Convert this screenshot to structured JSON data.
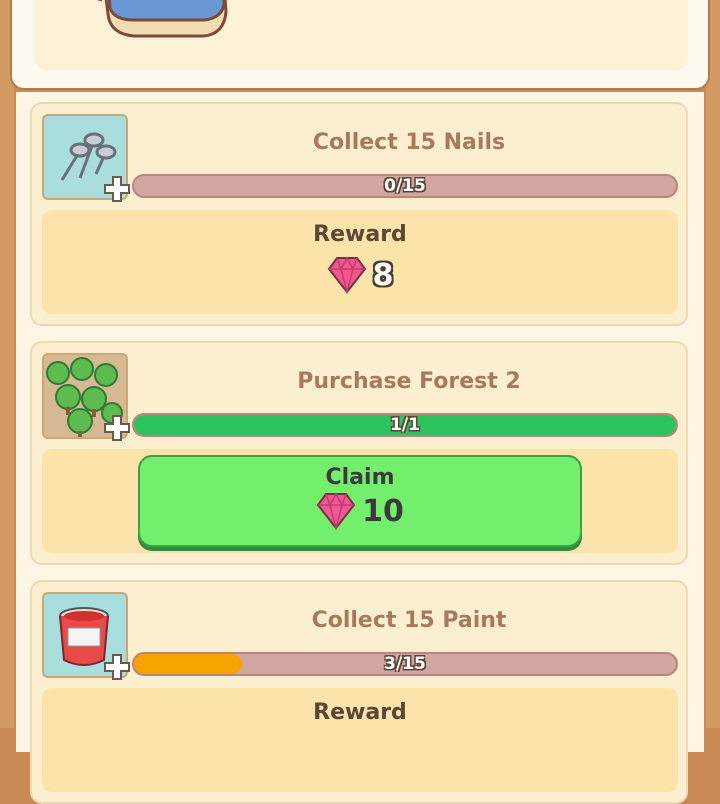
{
  "quests": [
    {
      "title": "Collect 15 Nails",
      "icon": "nails-icon",
      "progress_text": "0/15",
      "progress_fraction": 0,
      "bar_color": "#f7a300",
      "reward_label": "Reward",
      "reward_amount": "8"
    },
    {
      "title": "Purchase Forest 2",
      "icon": "forest-icon",
      "progress_text": "1/1",
      "progress_fraction": 1,
      "bar_color": "#2dc35c",
      "claim_label": "Claim",
      "reward_amount": "10"
    },
    {
      "title": "Collect 15 Paint",
      "icon": "paint-bucket-icon",
      "progress_text": "3/15",
      "progress_fraction": 0.2,
      "bar_color": "#f7a300",
      "reward_label": "Reward"
    }
  ],
  "colors": {
    "gem": "#f0588f",
    "claim_button": "#74ef6d",
    "progress_complete": "#2dc35c",
    "progress_partial": "#f7a300"
  }
}
